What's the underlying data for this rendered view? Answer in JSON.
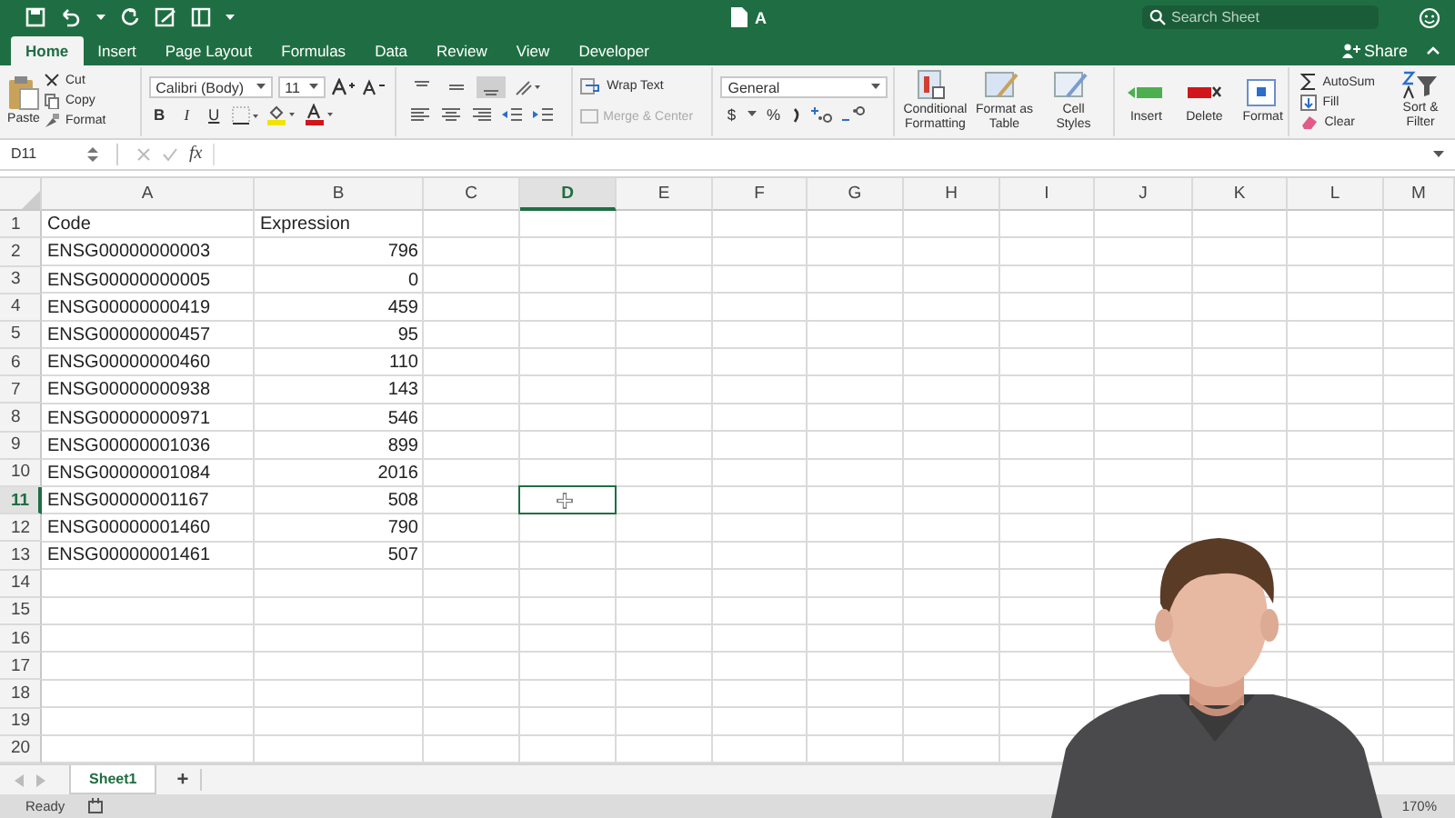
{
  "title_bar": {
    "title": "A",
    "search": {
      "placeholder": "Search Sheet"
    },
    "share": "Share"
  },
  "ribbon_tabs": [
    {
      "label": "Home",
      "selected": true
    },
    {
      "label": "Insert",
      "selected": false
    },
    {
      "label": "Page Layout",
      "selected": false
    },
    {
      "label": "Formulas",
      "selected": false
    },
    {
      "label": "Data",
      "selected": false
    },
    {
      "label": "Review",
      "selected": false
    },
    {
      "label": "View",
      "selected": false
    },
    {
      "label": "Developer",
      "selected": false
    }
  ],
  "ribbon": {
    "clipboard": {
      "paste": "Paste",
      "cut": "Cut",
      "copy": "Copy",
      "format": "Format"
    },
    "font": {
      "name": "Calibri (Body)",
      "size": "11",
      "bold": "B",
      "italic": "I",
      "underline": "U"
    },
    "alignment": {
      "wrap_text": "Wrap Text",
      "merge": "Merge & Center",
      "merge_disabled": true
    },
    "number": {
      "format": "General",
      "currency": "$",
      "percent": "%"
    },
    "styles": [
      "Conditional Formatting",
      "Format as Table",
      "Cell Styles"
    ],
    "cells": [
      "Insert",
      "Delete",
      "Format"
    ],
    "editing": {
      "autosum": "AutoSum",
      "fill": "Fill",
      "clear": "Clear",
      "sort": "Sort & Filter"
    }
  },
  "formula_bar": {
    "name_box": "D11",
    "fx": "fx"
  },
  "sheet": {
    "columns": [
      {
        "label": "A",
        "selected": false
      },
      {
        "label": "B",
        "selected": false
      },
      {
        "label": "C",
        "selected": false
      },
      {
        "label": "D",
        "selected": true
      },
      {
        "label": "E",
        "selected": false
      },
      {
        "label": "F",
        "selected": false
      },
      {
        "label": "G",
        "selected": false
      },
      {
        "label": "H",
        "selected": false
      },
      {
        "label": "I",
        "selected": false
      },
      {
        "label": "J",
        "selected": false
      },
      {
        "label": "K",
        "selected": false
      },
      {
        "label": "L",
        "selected": false
      },
      {
        "label": "M",
        "selected": false
      }
    ],
    "rows": [
      {
        "label": "1",
        "selected": false,
        "cells": [
          {
            "text": "Code",
            "kind": "text"
          },
          {
            "text": "Expression",
            "kind": "text"
          }
        ]
      },
      {
        "label": "2",
        "selected": false,
        "cells": [
          {
            "text": "ENSG00000000003",
            "kind": "text"
          },
          {
            "text": "796",
            "kind": "number"
          }
        ]
      },
      {
        "label": "3",
        "selected": false,
        "cells": [
          {
            "text": "ENSG00000000005",
            "kind": "text"
          },
          {
            "text": "0",
            "kind": "number"
          }
        ]
      },
      {
        "label": "4",
        "selected": false,
        "cells": [
          {
            "text": "ENSG00000000419",
            "kind": "text"
          },
          {
            "text": "459",
            "kind": "number"
          }
        ]
      },
      {
        "label": "5",
        "selected": false,
        "cells": [
          {
            "text": "ENSG00000000457",
            "kind": "text"
          },
          {
            "text": "95",
            "kind": "number"
          }
        ]
      },
      {
        "label": "6",
        "selected": false,
        "cells": [
          {
            "text": "ENSG00000000460",
            "kind": "text"
          },
          {
            "text": "110",
            "kind": "number"
          }
        ]
      },
      {
        "label": "7",
        "selected": false,
        "cells": [
          {
            "text": "ENSG00000000938",
            "kind": "text"
          },
          {
            "text": "143",
            "kind": "number"
          }
        ]
      },
      {
        "label": "8",
        "selected": false,
        "cells": [
          {
            "text": "ENSG00000000971",
            "kind": "text"
          },
          {
            "text": "546",
            "kind": "number"
          }
        ]
      },
      {
        "label": "9",
        "selected": false,
        "cells": [
          {
            "text": "ENSG00000001036",
            "kind": "text"
          },
          {
            "text": "899",
            "kind": "number"
          }
        ]
      },
      {
        "label": "10",
        "selected": false,
        "cells": [
          {
            "text": "ENSG00000001084",
            "kind": "text"
          },
          {
            "text": "2016",
            "kind": "number"
          }
        ]
      },
      {
        "label": "11",
        "selected": true,
        "cells": [
          {
            "text": "ENSG00000001167",
            "kind": "text"
          },
          {
            "text": "508",
            "kind": "number"
          }
        ]
      },
      {
        "label": "12",
        "selected": false,
        "cells": [
          {
            "text": "ENSG00000001460",
            "kind": "text"
          },
          {
            "text": "790",
            "kind": "number"
          }
        ]
      },
      {
        "label": "13",
        "selected": false,
        "cells": [
          {
            "text": "ENSG00000001461",
            "kind": "text"
          },
          {
            "text": "507",
            "kind": "number"
          }
        ]
      },
      {
        "label": "14",
        "selected": false
      },
      {
        "label": "15",
        "selected": false
      },
      {
        "label": "16",
        "selected": false
      },
      {
        "label": "17",
        "selected": false
      },
      {
        "label": "18",
        "selected": false
      },
      {
        "label": "19",
        "selected": false
      },
      {
        "label": "20",
        "selected": false
      }
    ]
  },
  "sheet_tabs": [
    {
      "label": "Sheet1",
      "selected": true
    }
  ],
  "add_sheet": "+",
  "status_bar": {
    "status": "Ready",
    "zoom": "170%"
  }
}
